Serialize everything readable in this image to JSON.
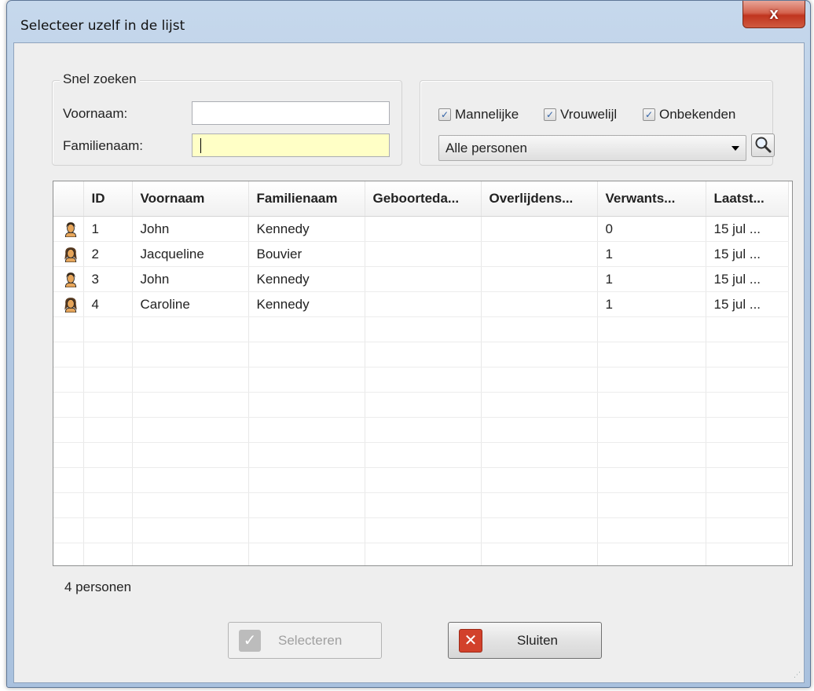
{
  "window": {
    "title": "Selecteer uzelf in de lijst",
    "close_label": "x"
  },
  "quick_search": {
    "legend": "Snel zoeken",
    "first_name_label": "Voornaam:",
    "first_name_value": "",
    "last_name_label": "Familienaam:",
    "last_name_value": ""
  },
  "filters": {
    "male_label": "Mannelijke",
    "female_label": "Vrouwelijl",
    "unknown_label": "Onbekenden",
    "male_checked": true,
    "female_checked": true,
    "unknown_checked": true,
    "scope_selected": "Alle personen",
    "search_icon": "magnifier-icon"
  },
  "table": {
    "columns": [
      "ID",
      "Voornaam",
      "Familienaam",
      "Geboorteda...",
      "Overlijdens...",
      "Verwants...",
      "Laatst..."
    ],
    "rows": [
      {
        "gender": "male",
        "id": "1",
        "first": "John",
        "last": "Kennedy",
        "birth": "",
        "death": "",
        "relation": "0",
        "last_changed": "15 jul ..."
      },
      {
        "gender": "female",
        "id": "2",
        "first": "Jacqueline",
        "last": "Bouvier",
        "birth": "",
        "death": "",
        "relation": "1",
        "last_changed": "15 jul ..."
      },
      {
        "gender": "male",
        "id": "3",
        "first": "John",
        "last": "Kennedy",
        "birth": "",
        "death": "",
        "relation": "1",
        "last_changed": "15 jul ..."
      },
      {
        "gender": "female",
        "id": "4",
        "first": "Caroline",
        "last": "Kennedy",
        "birth": "",
        "death": "",
        "relation": "1",
        "last_changed": "15 jul ..."
      }
    ]
  },
  "status": {
    "count_text": "4 personen"
  },
  "buttons": {
    "select_label": "Selecteren",
    "close_label": "Sluiten"
  },
  "colors": {
    "male_icon": "#e6a55a",
    "female_icon": "#e6a55a",
    "close_red": "#d2412b",
    "select_disabled": "#bcbcbc"
  }
}
